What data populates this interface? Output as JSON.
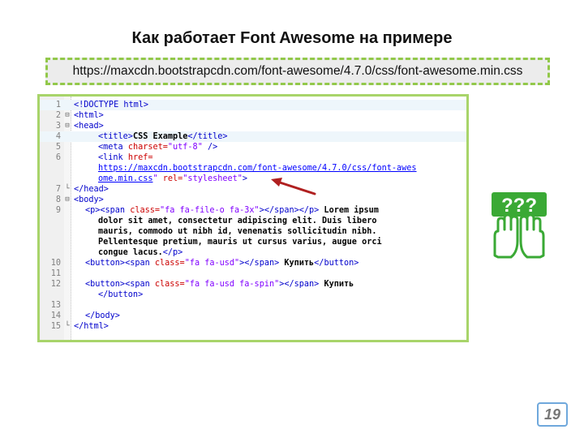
{
  "slide": {
    "title": "Как работает Font Awesome на примере",
    "url": "https://maxcdn.bootstrapcdn.com/font-awesome/4.7.0/css/font-awesome.min.css",
    "page_number": "19"
  },
  "code": {
    "lines": [
      {
        "n": "1",
        "marker": "",
        "tokens": [
          [
            "t",
            "<!DOCTYPE html>"
          ]
        ]
      },
      {
        "n": "2",
        "marker": "⊟",
        "tokens": [
          [
            "t",
            "<html>"
          ]
        ]
      },
      {
        "n": "3",
        "marker": "⊟",
        "tokens": [
          [
            "t",
            "<head>"
          ]
        ]
      },
      {
        "n": "4",
        "marker": "",
        "tokens": [
          [
            "t",
            "<title>"
          ],
          [
            "b",
            "CSS Example"
          ],
          [
            "t",
            "</title>"
          ]
        ]
      },
      {
        "n": "5",
        "marker": "",
        "tokens": [
          [
            "t",
            "<meta "
          ],
          [
            "a",
            "charset="
          ],
          [
            "s",
            "\"utf-8\""
          ],
          [
            "t",
            " />"
          ]
        ]
      },
      {
        "n": "6",
        "marker": "",
        "tokens": [
          [
            "t",
            "<link "
          ],
          [
            "a",
            "href="
          ]
        ]
      },
      {
        "n": "",
        "marker": "",
        "tokens": [
          [
            "u",
            "https://maxcdn.bootstrapcdn.com/font-awesome/4.7.0/css/font-awes"
          ]
        ]
      },
      {
        "n": "",
        "marker": "",
        "tokens": [
          [
            "u",
            "ome.min.css"
          ],
          [
            "s",
            "\""
          ],
          [
            "t",
            " "
          ],
          [
            "a",
            "rel="
          ],
          [
            "s",
            "\"stylesheet\""
          ],
          [
            "t",
            ">"
          ]
        ]
      },
      {
        "n": "7",
        "marker": "└",
        "tokens": [
          [
            "t",
            "</head>"
          ]
        ]
      },
      {
        "n": "8",
        "marker": "⊟",
        "tokens": [
          [
            "t",
            "<body>"
          ]
        ]
      },
      {
        "n": "9",
        "marker": "",
        "tokens": [
          [
            "t",
            "<p><span "
          ],
          [
            "a",
            "class="
          ],
          [
            "s",
            "\"fa fa-file-o fa-3x\""
          ],
          [
            "t",
            "></span></p>"
          ],
          [
            "b",
            " Lorem ipsum"
          ]
        ]
      },
      {
        "n": "",
        "marker": "",
        "tokens": [
          [
            "b",
            "dolor sit amet, consectetur adipiscing elit. Duis libero"
          ]
        ]
      },
      {
        "n": "",
        "marker": "",
        "tokens": [
          [
            "b",
            "mauris, commodo ut nibh id, venenatis sollicitudin nibh."
          ]
        ]
      },
      {
        "n": "",
        "marker": "",
        "tokens": [
          [
            "b",
            "Pellentesque pretium, mauris ut cursus varius, augue orci"
          ]
        ]
      },
      {
        "n": "",
        "marker": "",
        "tokens": [
          [
            "b",
            "congue lacus."
          ],
          [
            "t",
            "</p>"
          ]
        ]
      },
      {
        "n": "10",
        "marker": "",
        "tokens": [
          [
            "t",
            "<button><span "
          ],
          [
            "a",
            "class="
          ],
          [
            "s",
            "\"fa fa-usd\""
          ],
          [
            "t",
            "></span>"
          ],
          [
            "b",
            " Купить"
          ],
          [
            "t",
            "</button>"
          ]
        ]
      },
      {
        "n": "11",
        "marker": "",
        "tokens": []
      },
      {
        "n": "12",
        "marker": "",
        "tokens": [
          [
            "t",
            "<button><span "
          ],
          [
            "a",
            "class="
          ],
          [
            "s",
            "\"fa fa-usd fa-spin\""
          ],
          [
            "t",
            "></span>"
          ],
          [
            "b",
            " Купить"
          ]
        ]
      },
      {
        "n": "",
        "marker": "",
        "tokens": [
          [
            "t",
            "</button>"
          ]
        ]
      },
      {
        "n": "13",
        "marker": "",
        "tokens": []
      },
      {
        "n": "14",
        "marker": "",
        "tokens": [
          [
            "t",
            "</body>"
          ]
        ]
      },
      {
        "n": "15",
        "marker": "└",
        "tokens": [
          [
            "t",
            "</html>"
          ]
        ]
      }
    ]
  },
  "help_icon": {
    "label": "???",
    "color": "#3aa935",
    "name": "hands-question-icon"
  },
  "colors": {
    "accent_green": "#92c84a",
    "arrow_red": "#b02020",
    "page_border": "#6fa8dc"
  }
}
